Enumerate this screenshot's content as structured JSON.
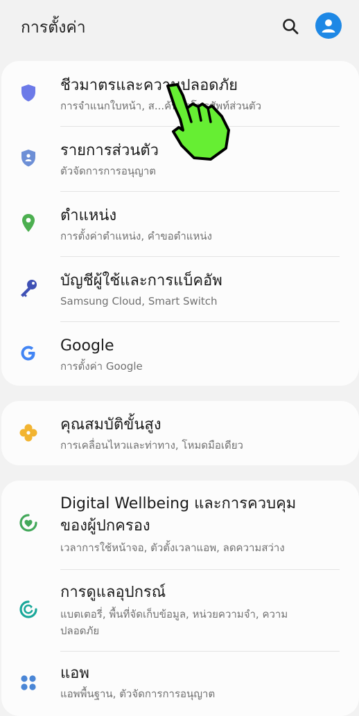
{
  "header": {
    "title": "การตั้งค่า",
    "search_icon": "search-icon",
    "avatar_icon": "account-icon"
  },
  "colors": {
    "accent": "#1e88e5",
    "shield": "#6c7ae8",
    "privacy": "#6d8fd6",
    "location": "#4caf50",
    "key": "#3f51b5",
    "google": "#4285f4",
    "advanced": "#f2b431",
    "wellbeing": "#43a85a",
    "care": "#1aa89a",
    "apps": "#4a86d6",
    "cursor": "#66ee33"
  },
  "cards": [
    {
      "items": [
        {
          "icon": "shield-icon",
          "title": "ชีวมาตรและความปลอดภัย",
          "subtitle": "การจำแนกใบหน้า, ส...ค้นหาโทรศัพท์ส่วนตัว"
        },
        {
          "icon": "privacy-shield-icon",
          "title": "รายการส่วนตัว",
          "subtitle": "ตัวจัดการการอนุญาต"
        },
        {
          "icon": "location-pin-icon",
          "title": "ตำแหน่ง",
          "subtitle": "การตั้งค่าตำแหน่ง, คำขอตำแหน่ง"
        },
        {
          "icon": "key-icon",
          "title": "บัญชีผู้ใช้และการแบ็คอัพ",
          "subtitle": "Samsung Cloud, Smart Switch"
        },
        {
          "icon": "google-icon",
          "title": "Google",
          "subtitle": "การตั้งค่า Google"
        }
      ]
    },
    {
      "items": [
        {
          "icon": "advanced-features-icon",
          "title": "คุณสมบัติขั้นสูง",
          "subtitle": "การเคลื่อนไหวและท่าทาง, โหมดมือเดียว"
        }
      ]
    },
    {
      "items": [
        {
          "icon": "digital-wellbeing-icon",
          "title_line1": "Digital Wellbeing และการควบคุม",
          "title_line2": "ของผู้ปกครอง",
          "subtitle": "เวลาการใช้หน้าจอ, ตัวตั้งเวลาแอพ, ลดความสว่าง"
        },
        {
          "icon": "device-care-icon",
          "title": "การดูแลอุปกรณ์",
          "subtitle_line1": "แบตเตอรี่, พื้นที่จัดเก็บข้อมูล, หน่วยความจำ, ความ",
          "subtitle_line2": "ปลอดภัย"
        },
        {
          "icon": "apps-icon",
          "title": "แอพ",
          "subtitle": "แอพพื้นฐาน, ตัวจัดการการอนุญาต"
        }
      ]
    }
  ],
  "overlay": {
    "icon": "pointing-hand-cursor-icon"
  }
}
